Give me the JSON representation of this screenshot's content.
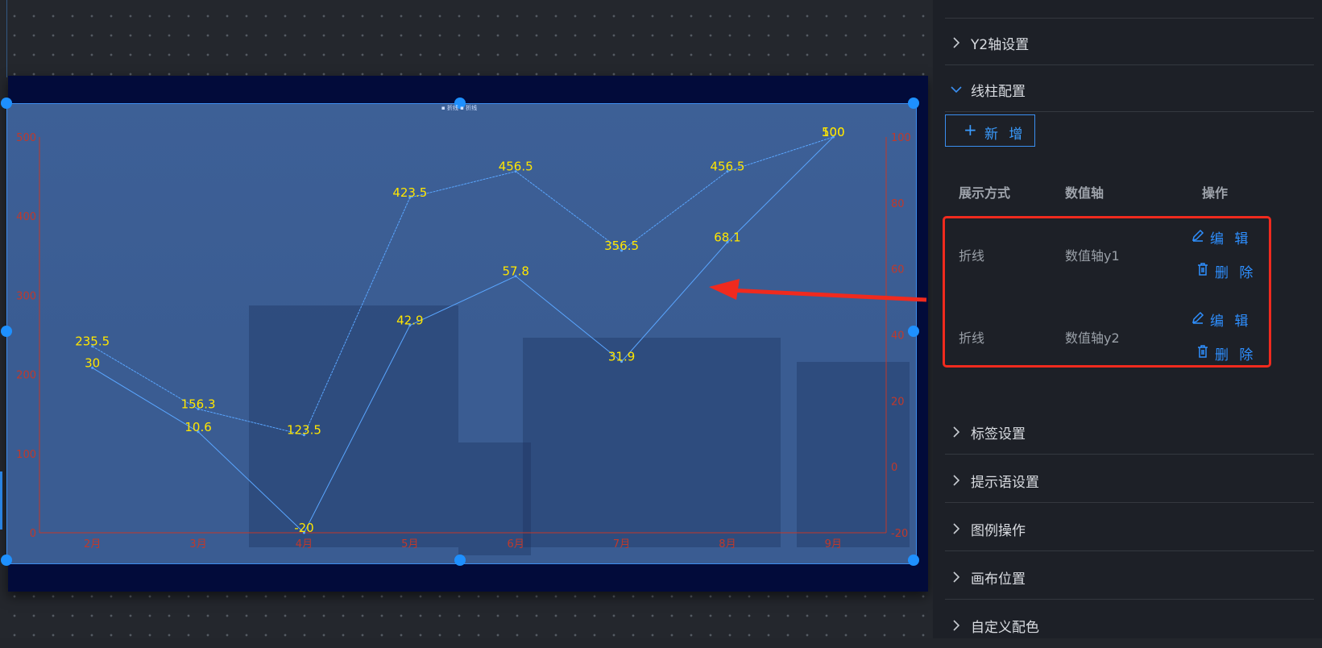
{
  "panel": {
    "sections_top": [
      {
        "label": "Y2轴设置",
        "expanded": false
      },
      {
        "label": "线柱配置",
        "expanded": true
      }
    ],
    "add_button": {
      "label": "新 增",
      "icon": "plus-icon"
    },
    "table": {
      "headers": [
        "展示方式",
        "数值轴",
        "操作"
      ],
      "rows": [
        {
          "display": "折线",
          "axis": "数值轴y1",
          "edit": "编 辑",
          "delete": "删 除"
        },
        {
          "display": "折线",
          "axis": "数值轴y2",
          "edit": "编 辑",
          "delete": "删 除"
        }
      ]
    },
    "sections_bottom": [
      {
        "label": "标签设置"
      },
      {
        "label": "提示语设置"
      },
      {
        "label": "图例操作"
      },
      {
        "label": "画布位置"
      },
      {
        "label": "自定义配色"
      }
    ]
  },
  "colors": {
    "accent": "#2e8fff",
    "highlight_box": "#f02a1e",
    "axis": "#c0392b",
    "data_label": "#ffe600",
    "series_line": "#5aa6ff"
  },
  "chart_data": {
    "type": "line",
    "legend_text": "▪ 折线 ▪ 折线",
    "categories": [
      "2月",
      "3月",
      "4月",
      "5月",
      "6月",
      "7月",
      "8月",
      "9月"
    ],
    "y_left": {
      "ticks": [
        "0",
        "100",
        "200",
        "300",
        "400",
        "500"
      ],
      "ylim": [
        0,
        500
      ]
    },
    "y_right": {
      "ticks": [
        "-20",
        "0",
        "20",
        "40",
        "60",
        "80",
        "100"
      ],
      "ylim": [
        -20,
        100
      ]
    },
    "series": [
      {
        "axis": "y1",
        "values": [
          235.5,
          156.3,
          123.5,
          423.5,
          456.5,
          356.5,
          456.5,
          500
        ]
      },
      {
        "axis": "y2",
        "values": [
          30,
          10.6,
          -20,
          42.9,
          57.8,
          31.9,
          68.1,
          100
        ]
      }
    ],
    "grid": false
  }
}
